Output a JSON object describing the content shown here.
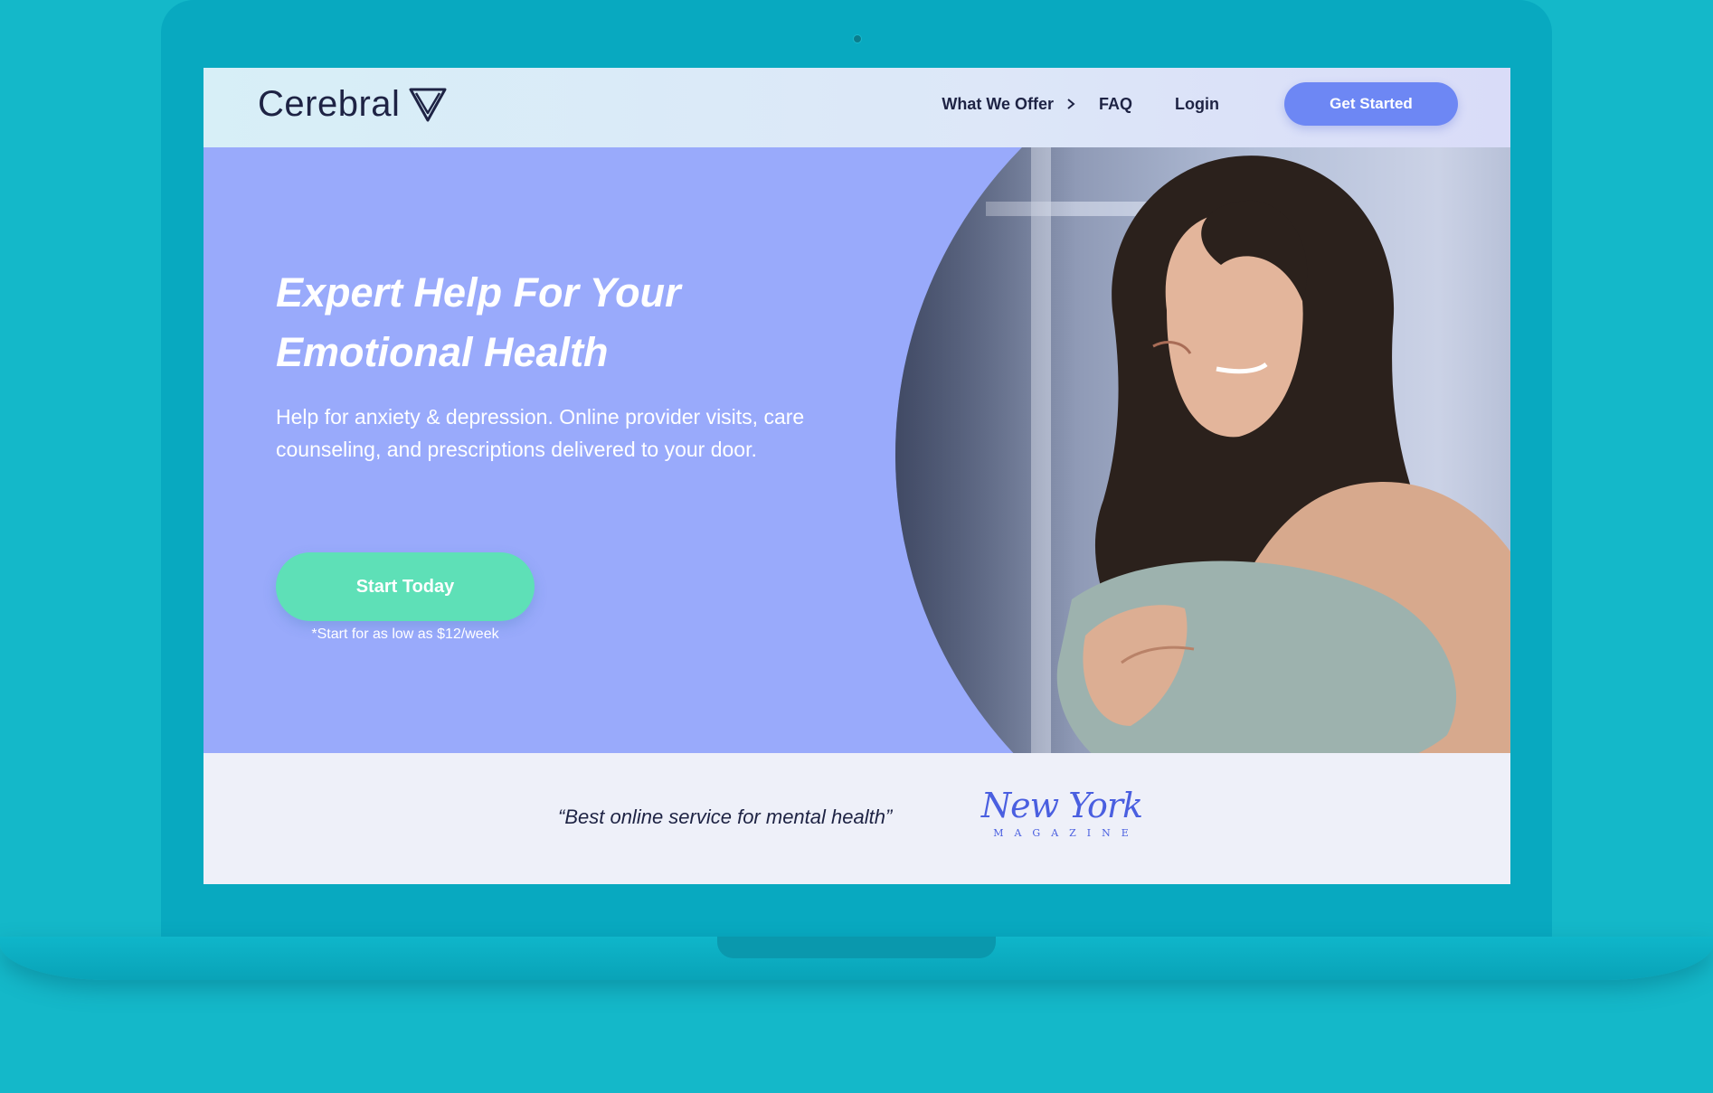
{
  "brand": {
    "name": "Cerebral",
    "logo_icon": "triangle-logo-icon"
  },
  "nav": {
    "what_we_offer": "What We Offer",
    "faq": "FAQ",
    "login": "Login",
    "get_started": "Get Started"
  },
  "hero": {
    "title": "Expert Help For Your Emotional Health",
    "subtitle": "Help for anxiety & depression. Online provider visits, care counseling, and prescriptions delivered to your door.",
    "cta": "Start Today",
    "price_note": "*Start for as low as $12/week"
  },
  "press": {
    "quote": "“Best online service for mental health”",
    "publication_title": "New York",
    "publication_sub": "MAGAZINE"
  },
  "colors": {
    "page_background": "#14b8c9",
    "hero_background": "#99aafb",
    "primary_button": "#6d87f4",
    "cta_button": "#5ee0b7",
    "text_dark": "#1e2344",
    "press_logo": "#4a5fe0"
  }
}
